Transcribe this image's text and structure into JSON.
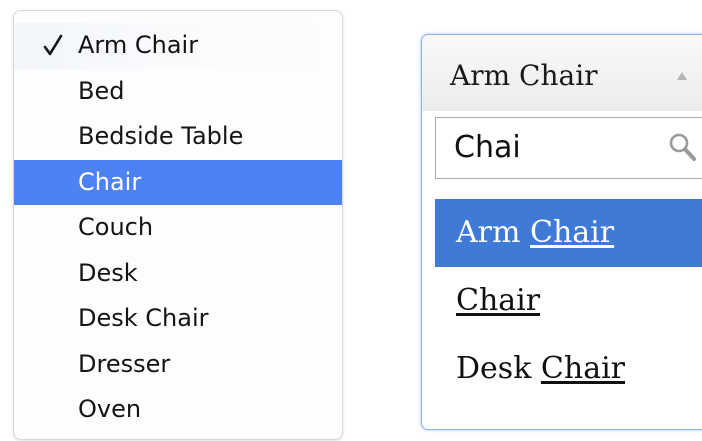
{
  "native_select": {
    "checked_index": 0,
    "highlighted_index": 3,
    "options": [
      "Arm Chair",
      "Bed",
      "Bedside Table",
      "Chair",
      "Couch",
      "Desk",
      "Desk Chair",
      "Dresser",
      "Oven"
    ]
  },
  "combobox": {
    "selected_value": "Arm Chair",
    "arrow_icon": "arrow-up-icon",
    "search": {
      "value": "Chai",
      "icon": "search-icon"
    },
    "highlighted_index": 0,
    "results": [
      {
        "prefix": "Arm ",
        "match": "Chair",
        "suffix": ""
      },
      {
        "prefix": "",
        "match": "Chair",
        "suffix": ""
      },
      {
        "prefix": "Desk ",
        "match": "Chair",
        "suffix": ""
      }
    ]
  },
  "colors": {
    "native_highlight": "#4d82f2",
    "combo_highlight": "#3f7ad6",
    "combo_border": "#8cb2ea"
  }
}
